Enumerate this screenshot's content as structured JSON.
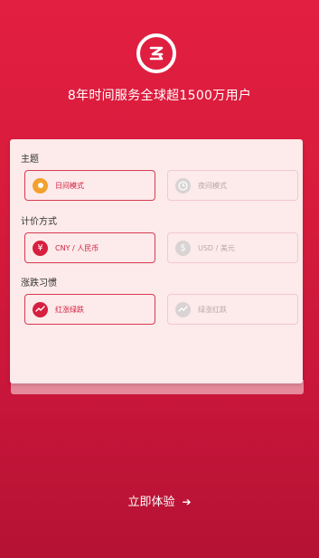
{
  "tagline": "8年时间服务全球超1500万用户",
  "sections": [
    {
      "title": "主题",
      "options": [
        "日间模式",
        "夜间模式"
      ]
    },
    {
      "title": "计价方式",
      "options": [
        "CNY / 人民币",
        "USD / 美元"
      ]
    },
    {
      "title": "涨跌习惯",
      "options": [
        "红涨绿跌",
        "绿涨红跌"
      ]
    }
  ],
  "icons": {
    "logo": "z-logo-icon",
    "day": "sun-icon",
    "night": "moon-icon",
    "cny": "yuan-icon",
    "usd": "dollar-icon",
    "red_up": "trend-up-icon",
    "green_up": "trend-up-icon"
  },
  "colors": {
    "accent": "#d71f3f",
    "sun": "#f2a12e",
    "card": "#fdeaea"
  },
  "cta": {
    "label": "立即体验",
    "arrow": "➔"
  }
}
